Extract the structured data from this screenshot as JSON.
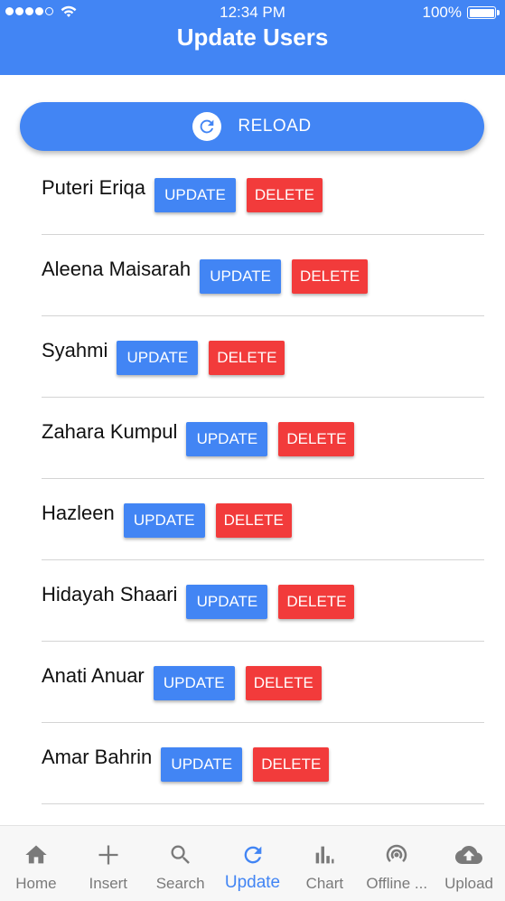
{
  "status_bar": {
    "time": "12:34 PM",
    "battery": "100%"
  },
  "header": {
    "title": "Update Users"
  },
  "reload_button": {
    "label": "RELOAD"
  },
  "users": [
    {
      "name": "Puteri Eriqa",
      "update_label": "UPDATE",
      "delete_label": "DELETE"
    },
    {
      "name": "Aleena Maisarah",
      "update_label": "UPDATE",
      "delete_label": "DELETE"
    },
    {
      "name": "Syahmi",
      "update_label": "UPDATE",
      "delete_label": "DELETE"
    },
    {
      "name": "Zahara Kumpul",
      "update_label": "UPDATE",
      "delete_label": "DELETE"
    },
    {
      "name": "Hazleen",
      "update_label": "UPDATE",
      "delete_label": "DELETE"
    },
    {
      "name": "Hidayah Shaari",
      "update_label": "UPDATE",
      "delete_label": "DELETE"
    },
    {
      "name": "Anati Anuar",
      "update_label": "UPDATE",
      "delete_label": "DELETE"
    },
    {
      "name": "Amar Bahrin",
      "update_label": "UPDATE",
      "delete_label": "DELETE"
    }
  ],
  "tabbar": {
    "active": "Update",
    "tabs": [
      {
        "label": "Home",
        "icon": "home-icon"
      },
      {
        "label": "Insert",
        "icon": "plus-icon"
      },
      {
        "label": "Search",
        "icon": "search-icon"
      },
      {
        "label": "Update",
        "icon": "refresh-icon"
      },
      {
        "label": "Chart",
        "icon": "bar-chart-icon"
      },
      {
        "label": "Offline ...",
        "icon": "broadcast-icon"
      },
      {
        "label": "Upload",
        "icon": "cloud-upload-icon"
      }
    ]
  },
  "colors": {
    "primary": "#4285f4",
    "danger": "#f23b3b",
    "tab_inactive": "#7a7a7a",
    "divider": "#d4d4d4"
  }
}
